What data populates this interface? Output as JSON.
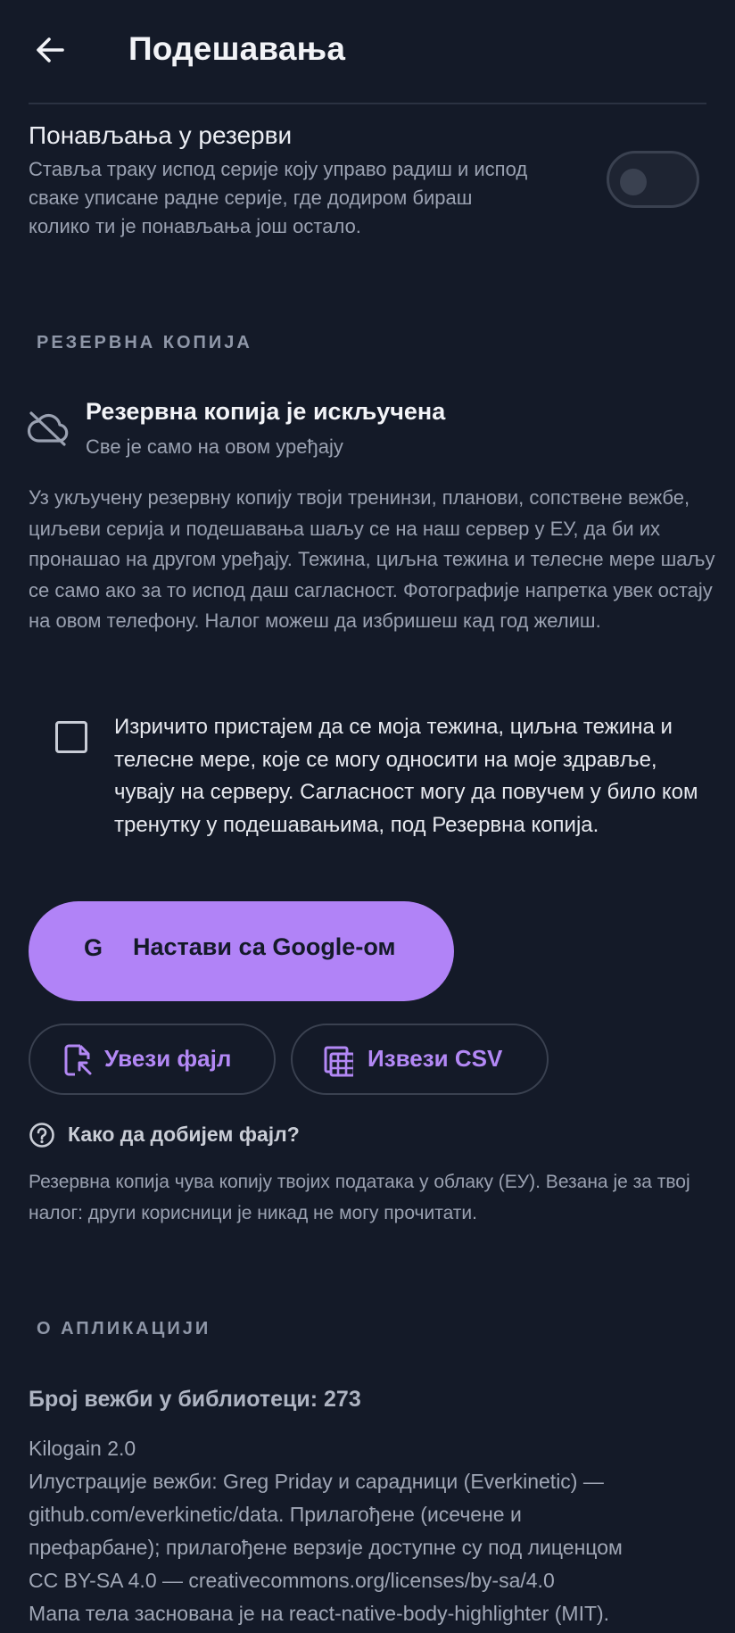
{
  "header": {
    "title": "Подешавања"
  },
  "rest_setting": {
    "title": "Понављања у резерви",
    "description": "Ставља траку испод серије коју управо радиш и испод сваке уписане радне серије, где додиром бираш колико ти је понављања још остало.",
    "enabled": false
  },
  "backup": {
    "section_label": "РЕЗЕРВНА КОПИЈА",
    "status_title": "Резервна копија је искључена",
    "status_subtitle": "Све је само на овом уређају",
    "info": "Уз укључену резервну копију твоји тренинзи, планови, сопствене вежбе, циљеви серија и подешавања шаљу се на наш сервер у ЕУ, да би их пронашао на другом уређају. Тежина, циљна тежина и телесне мере шаљу се само ако за то испод даш сагласност. Фотографије напретка увек остају на овом телефону. Налог можеш да избришеш кад год желиш.",
    "consent_text": "Изричито пристајем да се моја тежина, циљна тежина и телесне мере, које се могу односити на моје здравље, чувају на серверу. Сагласност могу да повучем у било ком тренутку у подешавањима, под Резервна копија.",
    "consent_checked": false,
    "google_button": "Настави са Google-ом",
    "google_glyph": "G",
    "import_button": "Увези фајл",
    "export_button": "Извези CSV",
    "help_link": "Како да добијем фајл?",
    "note": "Резервна копија чува копију твојих података у облаку (ЕУ). Везана је за твој налог: други корисници је никад не могу прочитати."
  },
  "about": {
    "section_label": "О АПЛИКАЦИЈИ",
    "exercise_count": "Број вежби у библиотеци: 273",
    "lines": [
      "Kilogain 2.0",
      "Илустрације вежби: Greg Priday и сарадници (Everkinetic) —",
      "github.com/everkinetic/data. Прилагођене (исечене и",
      "префарбане); прилагођене верзије доступне су под лиценцом",
      "CC BY-SA 4.0 — creativecommons.org/licenses/by-sa/4.0",
      "Мапа тела заснована је на react-native-body-highlighter (MIT)."
    ]
  },
  "colors": {
    "background": "#141a28",
    "accent": "#b183f7",
    "muted_text": "#9aa1b1"
  },
  "icons": {
    "back": "arrow-left-icon",
    "cloud": "cloud-off-icon",
    "import": "file-import-icon",
    "export": "spreadsheet-icon",
    "help": "help-circle-icon"
  }
}
